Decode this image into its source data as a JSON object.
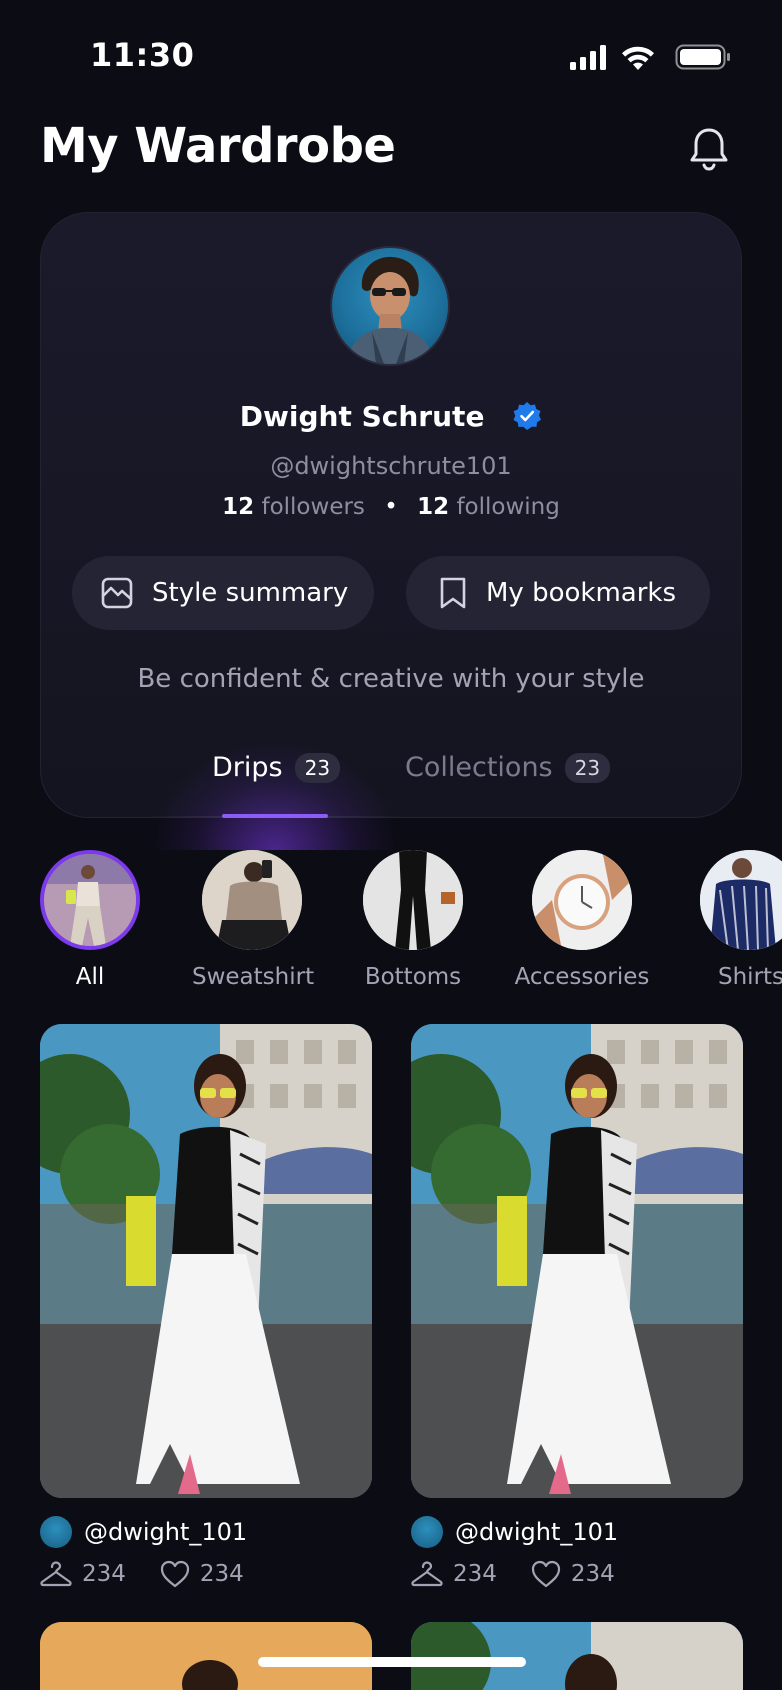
{
  "status_bar": {
    "time": "11:30"
  },
  "header": {
    "title": "My Wardrobe"
  },
  "profile": {
    "name": "Dwight Schrute",
    "handle": "@dwightschrute101",
    "followers_count": "12",
    "followers_label": "followers",
    "following_count": "12",
    "following_label": "following",
    "style_summary_label": "Style summary",
    "bookmarks_label": "My bookmarks",
    "tagline": "Be confident & creative with your style"
  },
  "tabs": [
    {
      "label": "Drips",
      "count": "23",
      "active": true
    },
    {
      "label": "Collections",
      "count": "23",
      "active": false
    }
  ],
  "categories": [
    {
      "label": "All",
      "active": true
    },
    {
      "label": "Sweatshirt",
      "active": false
    },
    {
      "label": "Bottoms",
      "active": false
    },
    {
      "label": "Accessories",
      "active": false
    },
    {
      "label": "Shirts",
      "active": false
    }
  ],
  "posts": [
    {
      "username": "@dwight_101",
      "hangers": "234",
      "likes": "234"
    },
    {
      "username": "@dwight_101",
      "hangers": "234",
      "likes": "234"
    }
  ],
  "colors": {
    "background": "#0c0c14",
    "card": "#1b1a2b",
    "accent": "#8b5cf6",
    "verified": "#1f7aec"
  },
  "icons": {
    "bell": "bell-icon",
    "verified": "verified-badge-icon",
    "style_summary": "chart-image-icon",
    "bookmarks": "bookmark-icon",
    "hanger": "hanger-icon",
    "heart": "heart-icon"
  }
}
